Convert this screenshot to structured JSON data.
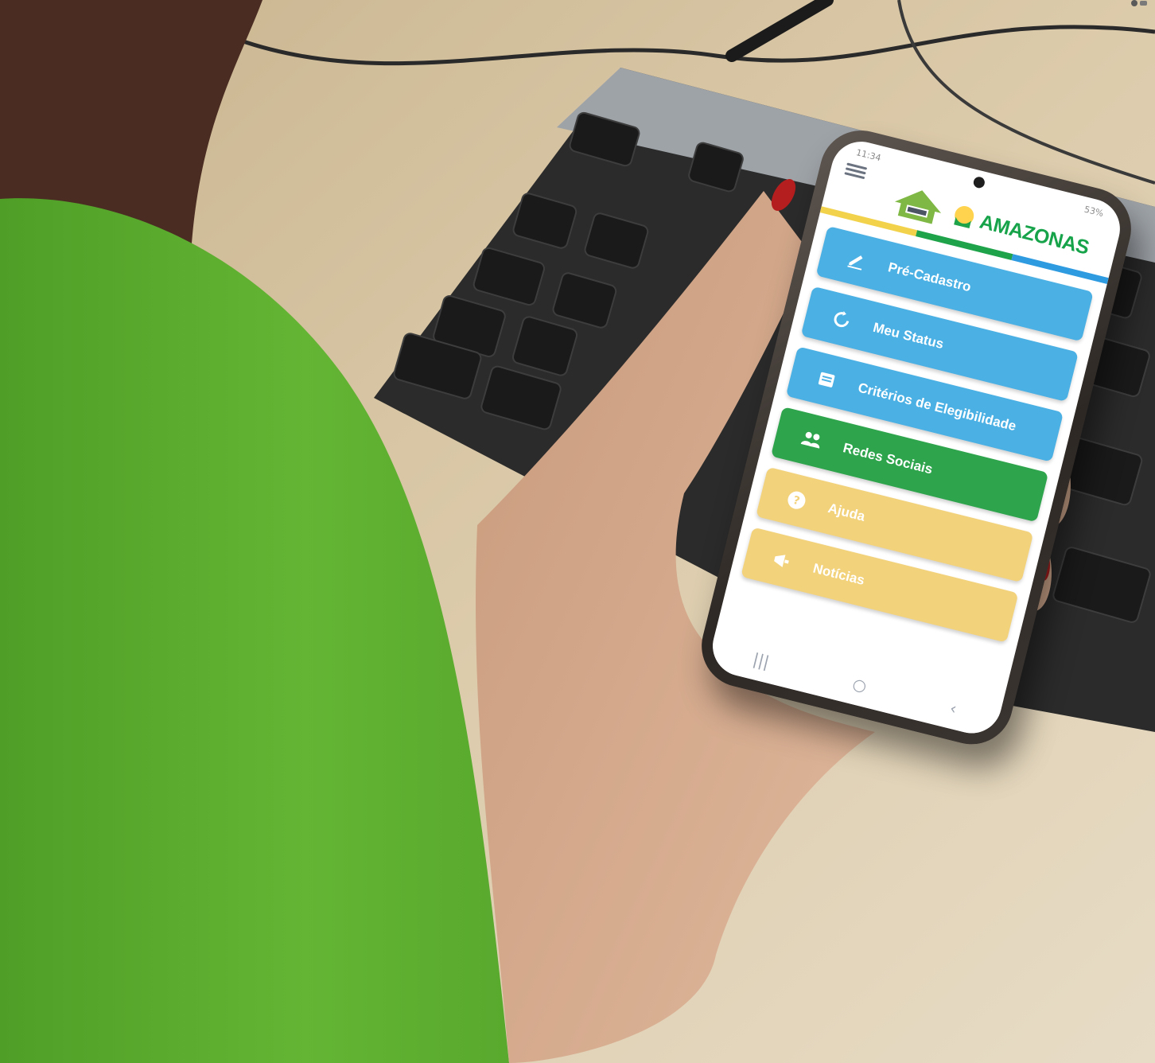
{
  "photo": {
    "description_role": "photograph of a hand holding a smartphone over a keyboard",
    "colors": {
      "shirt": "#59b02e",
      "desk": "#d6c6a8",
      "keyboard": "#2b2b2b",
      "skin": "#d7aa8e",
      "nail": "#b41e1e"
    }
  },
  "phone": {
    "status": {
      "time": "11:34",
      "battery": "53%"
    },
    "header": {
      "logo_left_icon": "house-logo-icon",
      "logo_right_icon": "amazonas-crest-icon",
      "logo_right_text": "AMAZONAS"
    },
    "stripe_colors": [
      "#f2d24b",
      "#1fa34a",
      "#2e9be0"
    ],
    "menu": [
      {
        "label": "Pré-Cadastro",
        "icon": "pencil-icon",
        "color": "#4bb0e4"
      },
      {
        "label": "Meu Status",
        "icon": "refresh-icon",
        "color": "#4bb0e4"
      },
      {
        "label": "Critérios de Elegibilidade",
        "icon": "document-icon",
        "color": "#4bb0e4"
      },
      {
        "label": "Redes Sociais",
        "icon": "users-icon",
        "color": "#2ea54d"
      },
      {
        "label": "Ajuda",
        "icon": "question-icon",
        "color": "#f3d27c"
      },
      {
        "label": "Notícias",
        "icon": "megaphone-icon",
        "color": "#f3d27c"
      }
    ],
    "nav": {
      "recent": "|||",
      "home": "○",
      "back": "‹"
    }
  }
}
